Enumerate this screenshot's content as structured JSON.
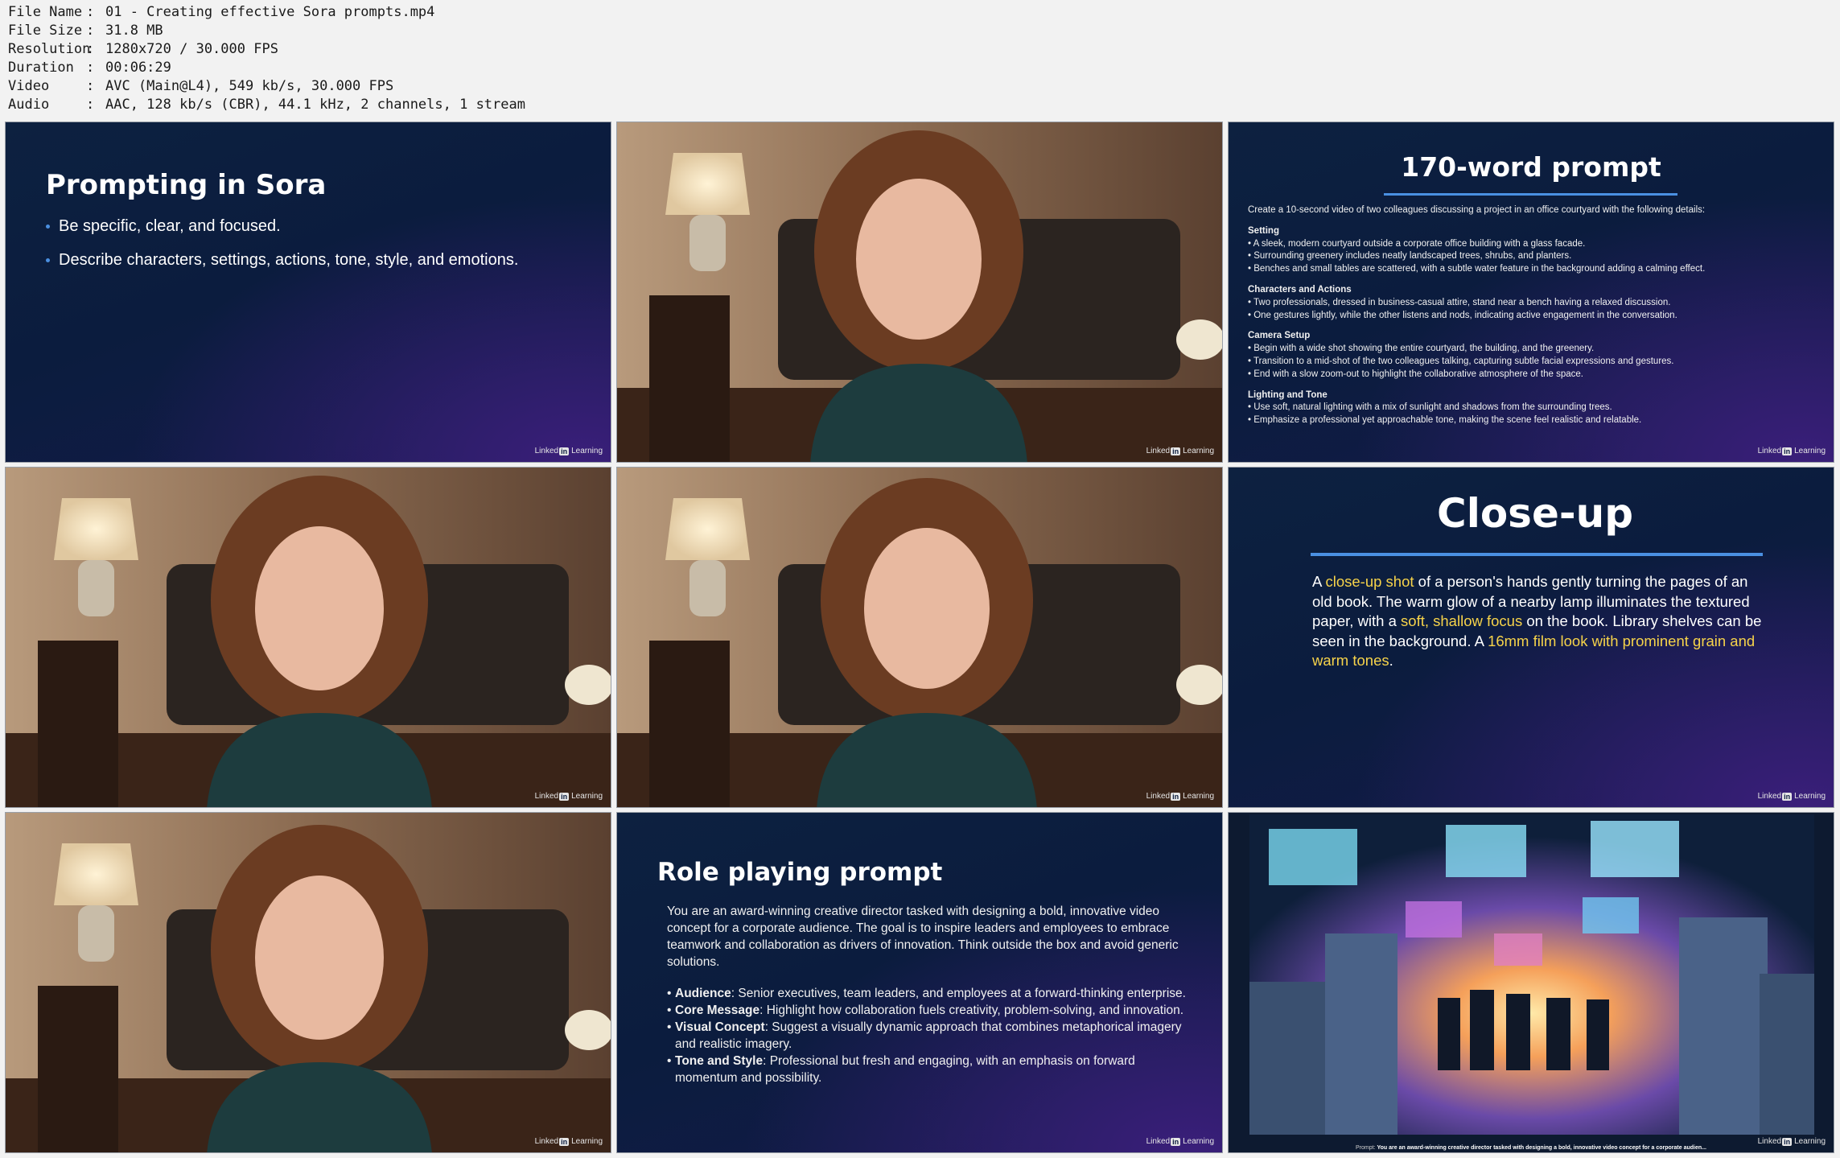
{
  "file_info": [
    {
      "key": "File Name",
      "value": "01 - Creating effective Sora prompts.mp4"
    },
    {
      "key": "File Size",
      "value": "31.8 MB"
    },
    {
      "key": "Resolution",
      "value": "1280x720 / 30.000 FPS"
    },
    {
      "key": "Duration",
      "value": "00:06:29"
    },
    {
      "key": "Video",
      "value": "AVC (Main@L4), 549 kb/s, 30.000 FPS"
    },
    {
      "key": "Audio",
      "value": "AAC, 128 kb/s (CBR), 44.1 kHz, 2 channels, 1 stream"
    }
  ],
  "separator": ":",
  "brand": {
    "prefix": "Linked",
    "box": "in",
    "suffix": "Learning"
  },
  "slide_prompting": {
    "title": "Prompting in Sora",
    "bullets": [
      "Be specific, clear, and focused.",
      "Describe characters, settings, actions, tone, style, and emotions."
    ]
  },
  "slide_170": {
    "title": "170-word prompt",
    "intro": "Create a 10-second video of two colleagues discussing a project in an office courtyard with the following details:",
    "sections": [
      {
        "heading": "Setting",
        "lines": [
          "• A sleek, modern courtyard outside a corporate office building with a glass facade.",
          "• Surrounding greenery includes neatly landscaped trees, shrubs, and planters.",
          "• Benches and small tables are scattered, with a subtle water feature in the background adding a calming effect."
        ]
      },
      {
        "heading": "Characters and Actions",
        "lines": [
          "• Two professionals, dressed in business-casual attire, stand near a bench having a relaxed discussion.",
          "• One gestures lightly, while the other listens and nods, indicating active engagement in the conversation."
        ]
      },
      {
        "heading": "Camera Setup",
        "lines": [
          "• Begin with a wide shot showing the entire courtyard, the building, and the greenery.",
          "• Transition to a mid-shot of the two colleagues talking, capturing subtle facial expressions and gestures.",
          "• End with a slow zoom-out to highlight the collaborative atmosphere of the space."
        ]
      },
      {
        "heading": "Lighting and Tone",
        "lines": [
          "• Use soft, natural lighting with a mix of sunlight and shadows from the surrounding trees.",
          "• Emphasize a professional yet approachable tone, making the scene feel realistic and relatable."
        ]
      }
    ]
  },
  "slide_closeup": {
    "title": "Close-up",
    "t1": "A ",
    "h1": "close-up shot",
    "t2": " of a person's hands gently turning the pages of an old book. The warm glow of a nearby lamp illuminates the textured paper, with a ",
    "h2": "soft, shallow focus",
    "t3": " on the book. Library shelves can be seen in the background. A ",
    "h3": "16mm film look with prominent grain and warm tones",
    "t4": "."
  },
  "slide_role": {
    "title": "Role playing prompt",
    "intro": "You are an award-winning creative director tasked with designing a bold, innovative video concept for a corporate audience. The goal is to inspire leaders and employees to embrace teamwork and collaboration as drivers of innovation. Think outside the box and avoid generic solutions.",
    "items": [
      {
        "label": "Audience",
        "text": ": Senior executives, team leaders, and employees at a forward-thinking enterprise."
      },
      {
        "label": "Core Message",
        "text": ": Highlight how collaboration fuels creativity, problem-solving, and innovation."
      },
      {
        "label": "Visual Concept",
        "text": ": Suggest a visually dynamic approach that combines metaphorical imagery and realistic imagery."
      },
      {
        "label": "Tone and Style",
        "text": ": Professional but fresh and engaging, with an emphasis on forward momentum and possibility."
      }
    ]
  },
  "slide_generated": {
    "caption_label": "Prompt:",
    "caption_text": "You are an award-winning creative director tasked with designing a bold, innovative video concept for a corporate audien..."
  },
  "colors": {
    "accent_rule": "#4a90e2",
    "highlight": "#f6d34a",
    "slide_bg": "#0b1c3e"
  }
}
